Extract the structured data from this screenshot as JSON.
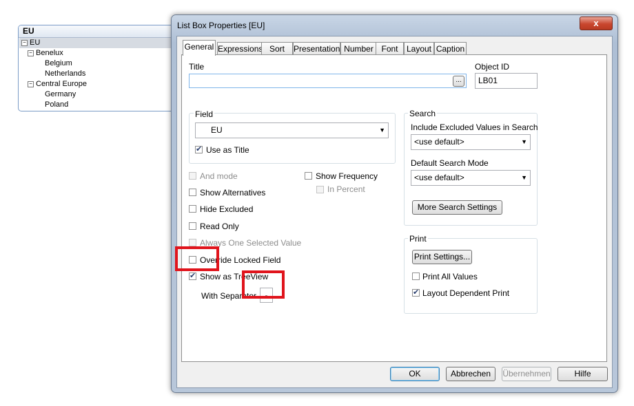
{
  "listbox": {
    "title": "EU",
    "tree": [
      {
        "label": "EU",
        "toggle": "−"
      },
      {
        "label": "Benelux",
        "toggle": "−"
      },
      {
        "label": "Belgium"
      },
      {
        "label": "Netherlands"
      },
      {
        "label": "Central Europe",
        "toggle": "−"
      },
      {
        "label": "Germany"
      },
      {
        "label": "Poland"
      }
    ]
  },
  "dialog": {
    "title": "List Box Properties [EU]",
    "close_glyph": "x",
    "tabs": [
      "General",
      "Expressions",
      "Sort",
      "Presentation",
      "Number",
      "Font",
      "Layout",
      "Caption"
    ],
    "title_label": "Title",
    "title_value": "",
    "title_browse_button": "...",
    "object_id_label": "Object ID",
    "object_id_value": "LB01",
    "field_group_label": "Field",
    "field_value": "EU",
    "use_as_title": "Use as Title",
    "search": {
      "group_label": "Search",
      "include_excluded_label": "Include Excluded Values in Search",
      "include_excluded_value": "<use default>",
      "default_mode_label": "Default Search Mode",
      "default_mode_value": "<use default>",
      "more_button": "More Search Settings"
    },
    "options": {
      "and_mode": "And mode",
      "show_alternatives": "Show Alternatives",
      "hide_excluded": "Hide Excluded",
      "read_only": "Read Only",
      "always_one_selected": "Always One Selected Value",
      "override_locked": "Override Locked Field",
      "show_as_treeview": "Show as TreeView",
      "with_separator_label": "With Separator",
      "separator_value": "-",
      "show_frequency": "Show Frequency",
      "in_percent": "In Percent"
    },
    "print": {
      "group_label": "Print",
      "settings_button": "Print Settings...",
      "print_all_values": "Print All Values",
      "layout_dependent": "Layout Dependent Print"
    },
    "footer": {
      "ok": "OK",
      "cancel": "Abbrechen",
      "apply": "Übernehmen",
      "help": "Hilfe"
    }
  },
  "colors": {
    "highlight_box": "#e0141c",
    "accent": "#3c7fb1"
  },
  "icons": {
    "checkmark": "✔",
    "dropdown": "▼"
  }
}
